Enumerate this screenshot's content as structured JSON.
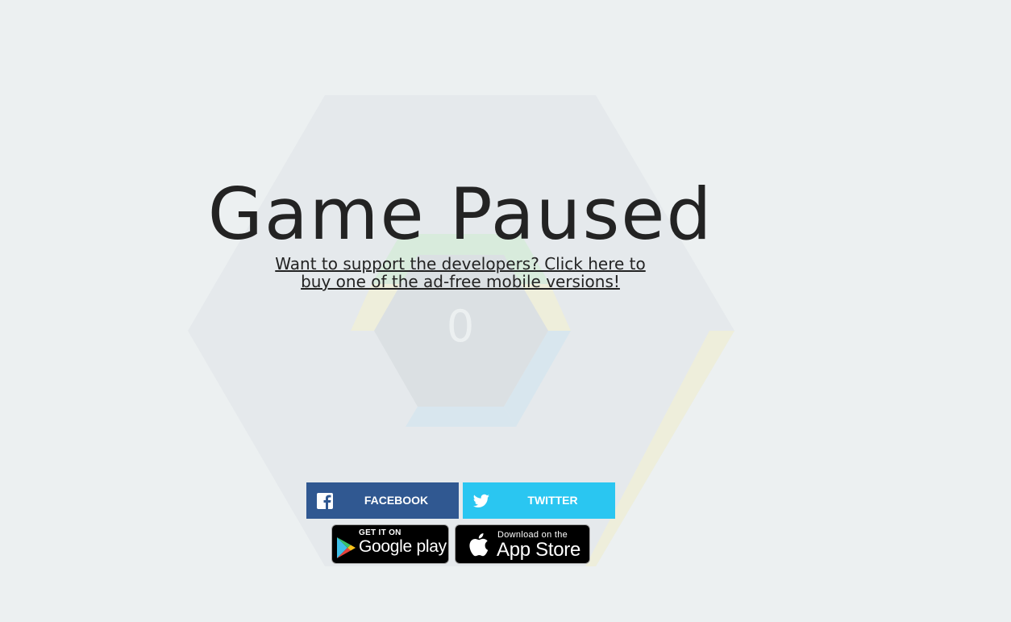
{
  "game": {
    "title": "Game Paused",
    "score": "0"
  },
  "support_link": {
    "text": "Want to support the developers? Click here to buy one of the ad-free mobile versions!"
  },
  "share": {
    "facebook": {
      "label": "FACEBOOK",
      "icon": "facebook-icon",
      "color": "#305891"
    },
    "twitter": {
      "label": "TWITTER",
      "icon": "twitter-icon",
      "color": "#2ac6f1"
    }
  },
  "stores": {
    "google_play": {
      "small": "GET IT ON",
      "big": "Google play",
      "icon": "google-play-icon"
    },
    "app_store": {
      "small": "Download on the",
      "big": "App Store",
      "icon": "apple-icon"
    }
  },
  "colors": {
    "background": "#ecf0f1",
    "outer_hexagon": "#e5e9ec",
    "center_hexagon": "#dbe0e3",
    "lane_green": "#d8ebdc",
    "lane_yellow": "#eeeedb",
    "lane_blue": "#d8e6ee",
    "text": "#232323"
  }
}
